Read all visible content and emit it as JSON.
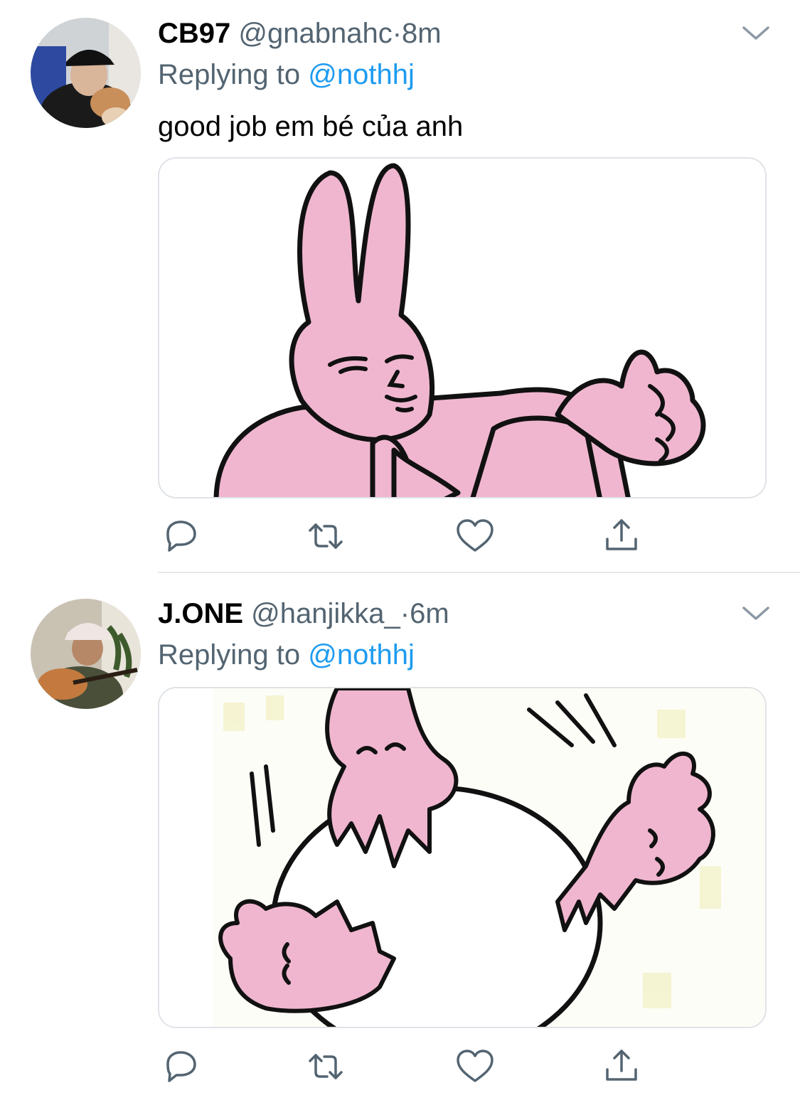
{
  "tweets": [
    {
      "name": "CB97",
      "handle": "@gnabnahc",
      "separator": "·",
      "time": "8m",
      "replying_prefix": "Replying to",
      "replying_to": "@nothhj",
      "text": "good job em bé của anh",
      "avatar": "user-photo-cap-with-dog",
      "media": "pink-bunny-thumbs-up-sticker"
    },
    {
      "name": "J.ONE",
      "handle": "@hanjikka_",
      "separator": "·",
      "time": "6m",
      "replying_prefix": "Replying to",
      "replying_to": "@nothhj",
      "avatar": "user-photo-guitar-bucket-hat",
      "media": "pink-bunnies-rolling-sticker"
    }
  ],
  "icons": {
    "reply": "reply-icon",
    "retweet": "retweet-icon",
    "like": "heart-icon",
    "share": "share-icon",
    "menu": "chevron-down-icon"
  },
  "colors": {
    "name": "#000000",
    "muted": "#536471",
    "link": "#1d9bf0",
    "sticker_pink": "#f0b6cf",
    "border": "#dfe3e7"
  }
}
